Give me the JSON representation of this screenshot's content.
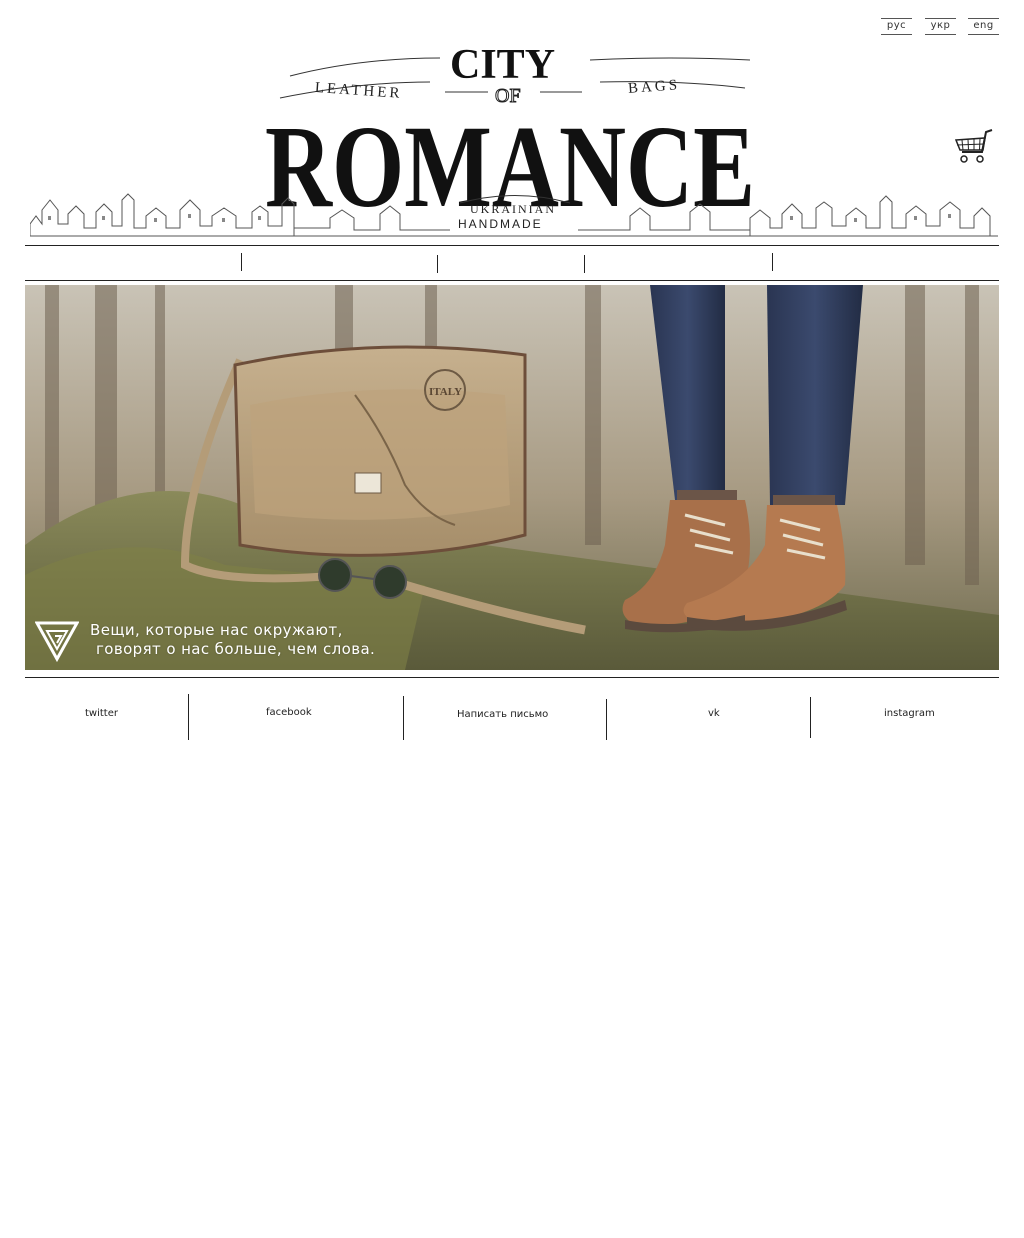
{
  "languages": [
    {
      "label": "рус"
    },
    {
      "label": "укр"
    },
    {
      "label": "eng"
    }
  ],
  "logo": {
    "city": "CITY",
    "of": "OF",
    "romance": "ROMANCE",
    "left_arc": "LEATHER",
    "right_arc": "BAGS",
    "badge_top": "UKRAINIAN",
    "badge_bottom": "HANDMADE"
  },
  "cart": {
    "icon": "shopping-cart-icon"
  },
  "hero": {
    "caption_line1": "Вещи, которые нас окружают,",
    "caption_line2": "говорят о нас больше, чем слова.",
    "map_label": "ITALY"
  },
  "footer": {
    "links": [
      {
        "label": "twitter"
      },
      {
        "label": "facebook"
      },
      {
        "label": "Написать письмо"
      },
      {
        "label": "vk"
      },
      {
        "label": "instagram"
      }
    ]
  }
}
